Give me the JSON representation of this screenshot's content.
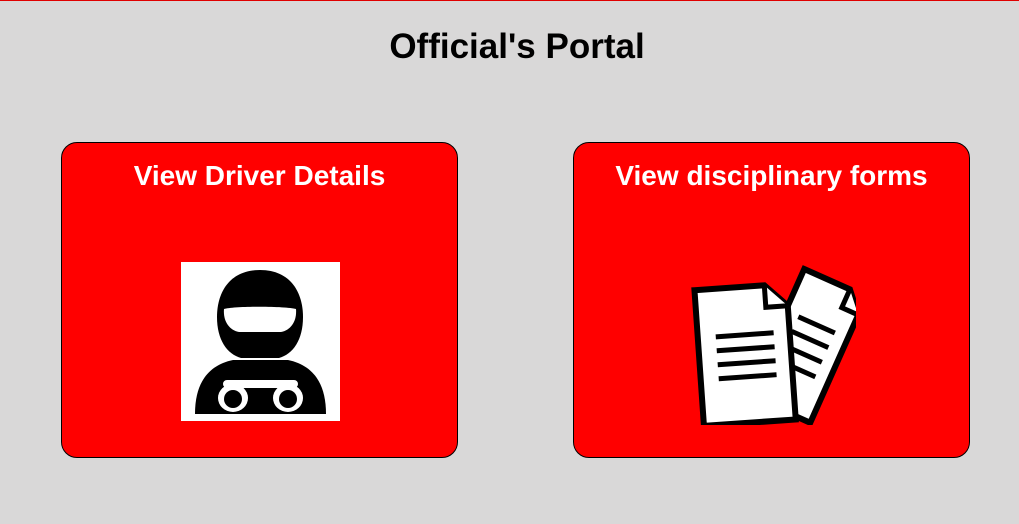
{
  "page": {
    "title": "Official's Portal"
  },
  "cards": [
    {
      "label": "View Driver Details",
      "icon": "driver-helmet-icon"
    },
    {
      "label": "View disciplinary forms",
      "icon": "documents-icon"
    }
  ],
  "colors": {
    "background": "#d9d8d8",
    "card": "#ff0000",
    "accent_line": "#e00000",
    "card_text": "#ffffff"
  }
}
